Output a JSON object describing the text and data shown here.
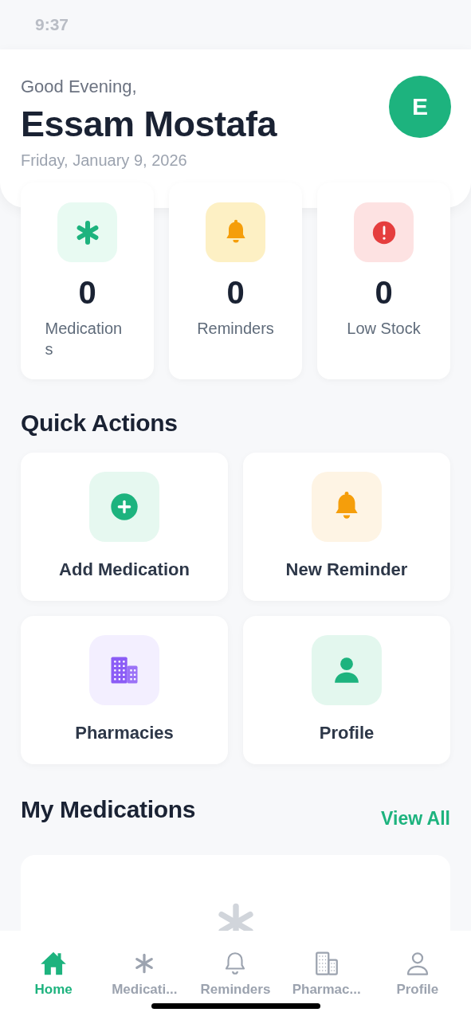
{
  "status_bar": {
    "time": "9:37"
  },
  "header": {
    "greeting": "Good Evening,",
    "name": "Essam Mostafa",
    "date": "Friday, January 9, 2026",
    "avatar_initial": "E"
  },
  "stats": [
    {
      "kind": "medications",
      "value": "0",
      "label": "Medications"
    },
    {
      "kind": "reminders",
      "value": "0",
      "label": "Reminders"
    },
    {
      "kind": "low_stock",
      "value": "0",
      "label": "Low Stock"
    }
  ],
  "quick_actions": {
    "title": "Quick Actions",
    "items": [
      {
        "kind": "add",
        "label": "Add Medication"
      },
      {
        "kind": "reminder",
        "label": "New Reminder"
      },
      {
        "kind": "pharmacies",
        "label": "Pharmacies"
      },
      {
        "kind": "profile",
        "label": "Profile"
      }
    ]
  },
  "my_medications": {
    "title": "My Medications",
    "link": "View All"
  },
  "tab_bar": [
    {
      "kind": "home",
      "label": "Home",
      "selected": true
    },
    {
      "kind": "medications",
      "label": "Medicati...",
      "selected": false
    },
    {
      "kind": "reminders",
      "label": "Reminders",
      "selected": false
    },
    {
      "kind": "pharmacies",
      "label": "Pharmac...",
      "selected": false
    },
    {
      "kind": "profile",
      "label": "Profile",
      "selected": false
    }
  ]
}
